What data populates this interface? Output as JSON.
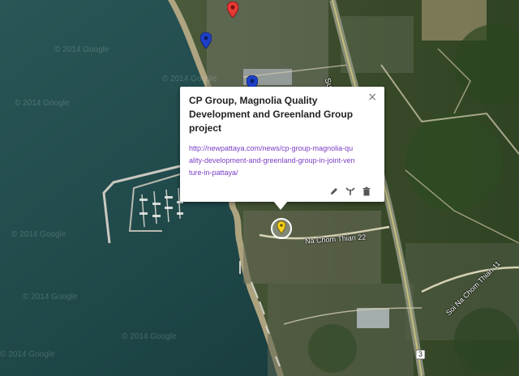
{
  "map": {
    "type": "satellite",
    "watermark": "© 2014 Google",
    "labels": {
      "road_sukhumvit": "Sukhumvit",
      "road_na_chom_thian_22": "Na Chom Thian 22",
      "road_soi_na_chom_thian_11": "Soi Na Chom Thian 11",
      "route_shield": "3"
    },
    "markers": [
      {
        "color": "#e53935",
        "icon": "red-pin-icon"
      },
      {
        "color": "#1e40c8",
        "icon": "blue-pin-icon"
      },
      {
        "color": "#1e40c8",
        "icon": "blue-pin-icon"
      },
      {
        "color": "#f7d21b",
        "icon": "yellow-pin-icon",
        "selected": true
      }
    ]
  },
  "popup": {
    "title": "CP Group, Magnolia Quality Development and Greenland Group project",
    "link": "http://newpattaya.com/news/cp-group-magnolia-quality-development-and-greenland-group-in-joint-venture-in-pattaya/",
    "close_symbol": "×",
    "actions": [
      "pencil-icon",
      "style-icon",
      "trash-icon"
    ]
  }
}
